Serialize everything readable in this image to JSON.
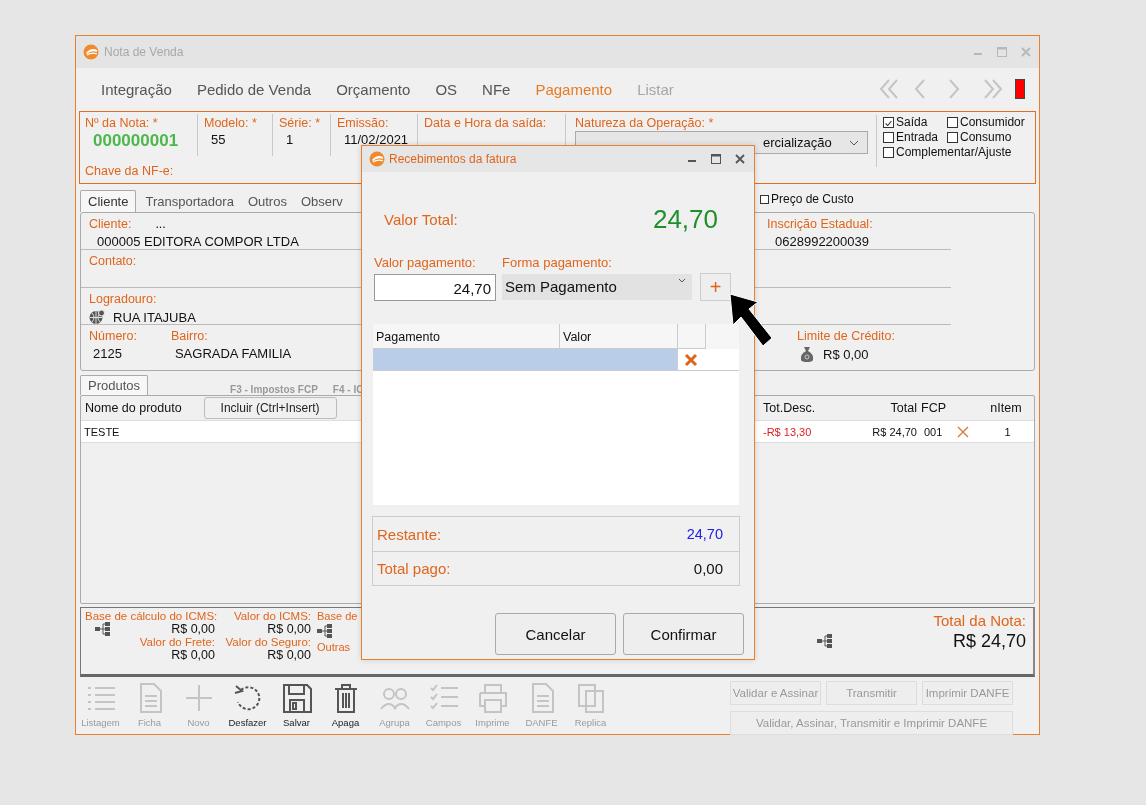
{
  "window": {
    "title": "Nota de Venda"
  },
  "nav_tabs": [
    {
      "label": "Integração",
      "selected": false,
      "disabled": false
    },
    {
      "label": "Pedido de Venda",
      "selected": false,
      "disabled": false
    },
    {
      "label": "Orçamento",
      "selected": false,
      "disabled": false
    },
    {
      "label": "OS",
      "selected": false,
      "disabled": false
    },
    {
      "label": "NFe",
      "selected": false,
      "disabled": false
    },
    {
      "label": "Pagamento",
      "selected": true,
      "disabled": false
    },
    {
      "label": "Listar",
      "selected": false,
      "disabled": true
    }
  ],
  "header": {
    "fields": [
      {
        "label": "Nº da Nota: *",
        "value": "000000001",
        "kind": "number"
      },
      {
        "label": "Modelo: *",
        "value": "55",
        "kind": "text"
      },
      {
        "label": "Série: *",
        "value": "1",
        "kind": "text"
      },
      {
        "label": "Emissão:",
        "value": "11/02/2021",
        "kind": "text"
      },
      {
        "label": "Data e Hora da saída:",
        "kind": "text"
      },
      {
        "label": "Natureza da Operação: *",
        "value": "ercialização",
        "kind": "select"
      }
    ],
    "key_label": "Chave da NF-e:",
    "options": [
      {
        "label": "Saída",
        "checked": true
      },
      {
        "label": "Consumidor",
        "checked": false
      },
      {
        "label": "Entrada",
        "checked": false
      },
      {
        "label": "Consumo",
        "checked": false
      },
      {
        "label": "Complementar/Ajuste",
        "checked": false
      }
    ]
  },
  "client_tabs": [
    {
      "label": "Cliente",
      "selected": true
    },
    {
      "label": "Transportadora",
      "selected": false
    },
    {
      "label": "Outros",
      "selected": false
    },
    {
      "label": "Observ",
      "selected": false
    }
  ],
  "cost_price": {
    "label": "Preço de Custo",
    "checked": false
  },
  "client": {
    "cliente_label": "Cliente:",
    "cliente_button": "...",
    "cliente_value": "000005 EDITORA COMPOR LTDA",
    "ie_label": "Inscrição Estadual:",
    "ie_value": "0628992200039",
    "contato_label": "Contato:",
    "logradouro_label": "Logradouro:",
    "logradouro_value": "RUA ITAJUBA",
    "numero_label": "Número:",
    "numero_value": "2125",
    "bairro_label": "Bairro:",
    "bairro_value": "SAGRADA FAMILIA",
    "credit_label": "Limite de Crédito:",
    "credit_value": "R$ 0,00"
  },
  "products": {
    "tab": "Produtos",
    "shortcuts": [
      "F3 - Impostos FCP",
      "F4 - IC"
    ],
    "add_button": "Incluir (Ctrl+Insert)",
    "columns": [
      "Nome do produto",
      "Tot.Desc.",
      "Total",
      "FCP",
      "nItem"
    ],
    "rows": [
      {
        "cells": [
          "TESTE",
          "-R$ 13,30",
          "R$ 24,70",
          "001",
          "1"
        ]
      }
    ]
  },
  "totals": {
    "base_icms": {
      "label": "Base de cálculo do ICMS:",
      "value": "R$ 0,00"
    },
    "icms": {
      "label": "Valor do ICMS:",
      "value": "R$ 0,00"
    },
    "frete": {
      "label": "Valor do Frete:",
      "value": "R$ 0,00"
    },
    "seguro": {
      "label": "Valor do Seguro:",
      "value": "R$ 0,00"
    },
    "cut_labels": [
      "Base de",
      "Outras"
    ],
    "total_label": "Total da Nota:",
    "total_value": "R$ 24,70"
  },
  "toolbar": [
    {
      "label": "Listagem",
      "kind": "list",
      "disabled": true
    },
    {
      "label": "Ficha",
      "kind": "doc",
      "disabled": true
    },
    {
      "label": "Novo",
      "kind": "plus",
      "disabled": true
    },
    {
      "label": "Desfazer",
      "kind": "undo",
      "disabled": false
    },
    {
      "label": "Salvar",
      "kind": "save",
      "disabled": false
    },
    {
      "label": "Apaga",
      "kind": "trash",
      "disabled": false
    },
    {
      "label": "Agrupa",
      "kind": "group",
      "disabled": true
    },
    {
      "label": "Campos",
      "kind": "checklist",
      "disabled": true
    },
    {
      "label": "Imprime",
      "kind": "printer",
      "disabled": true
    },
    {
      "label": "DANFE",
      "kind": "doc",
      "disabled": true
    },
    {
      "label": "Replica",
      "kind": "copy",
      "disabled": true
    }
  ],
  "actions": [
    {
      "label": "Validar e Assinar",
      "disabled": true
    },
    {
      "label": "Transmitir",
      "disabled": true
    },
    {
      "label": "Imprimir DANFE",
      "disabled": true
    },
    {
      "label": "Validar, Assinar, Transmitir e Imprimir DANFE",
      "disabled": true
    }
  ],
  "dialog": {
    "title": "Recebimentos da fatura",
    "total_label": "Valor Total:",
    "total_value": "24,70",
    "amount_label": "Valor pagamento:",
    "amount_value": "24,70",
    "method_label": "Forma pagamento:",
    "method_value": "Sem Pagamento",
    "add_button": "+",
    "columns": [
      "Pagamento",
      "Valor"
    ],
    "rows": [
      {
        "selected": true
      }
    ],
    "remaining_label": "Restante:",
    "remaining_value": "24,70",
    "paid_label": "Total pago:",
    "paid_value": "0,00",
    "buttons": [
      "Cancelar",
      "Confirmar"
    ]
  }
}
